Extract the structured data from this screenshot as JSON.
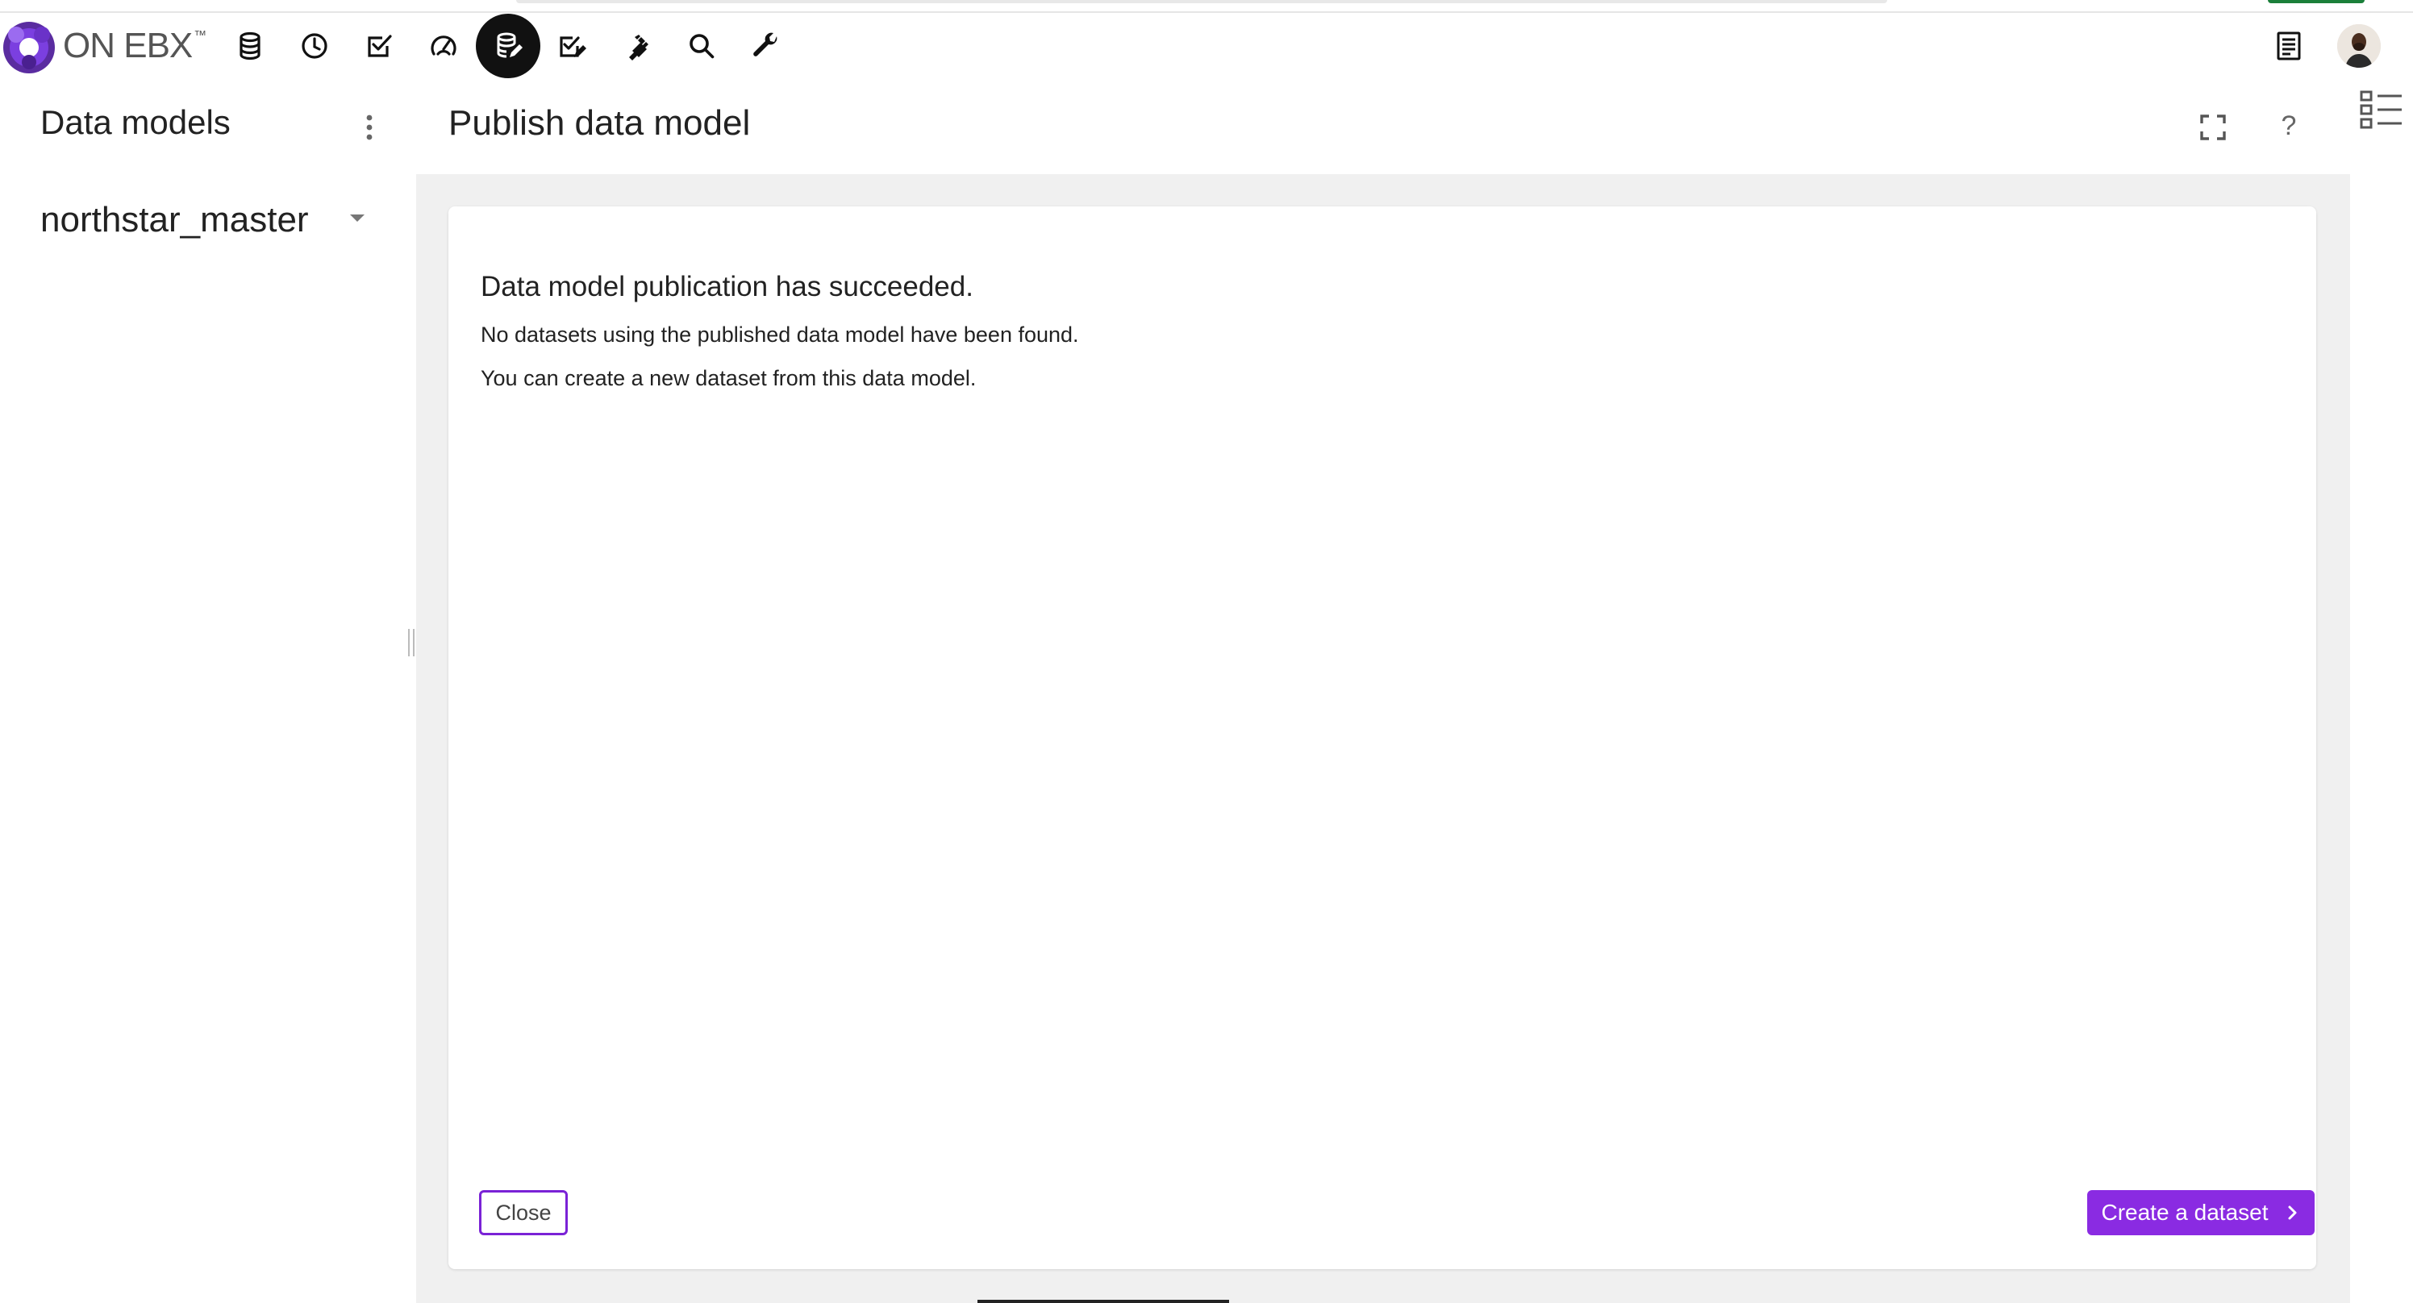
{
  "brand": {
    "name": "ON EBX",
    "trademark": "™",
    "accent_color": "#8a2be2"
  },
  "nav": {
    "icons": [
      {
        "name": "database-icon"
      },
      {
        "name": "history-clock-icon"
      },
      {
        "name": "task-check-icon"
      },
      {
        "name": "dashboard-gauge-icon"
      },
      {
        "name": "data-modeling-icon",
        "active": true
      },
      {
        "name": "workflow-edit-icon"
      },
      {
        "name": "plugin-icon"
      },
      {
        "name": "search-icon"
      },
      {
        "name": "administration-wrench-icon"
      }
    ]
  },
  "left_panel": {
    "title": "Data models",
    "selected_model": "northstar_master"
  },
  "main": {
    "title": "Publish data model",
    "help": "?",
    "heading": "Data model publication has succeeded.",
    "lines": [
      "No datasets using the published data model have been found.",
      "You can create a new dataset from this data model."
    ],
    "close_label": "Close",
    "create_label": "Create a dataset"
  }
}
